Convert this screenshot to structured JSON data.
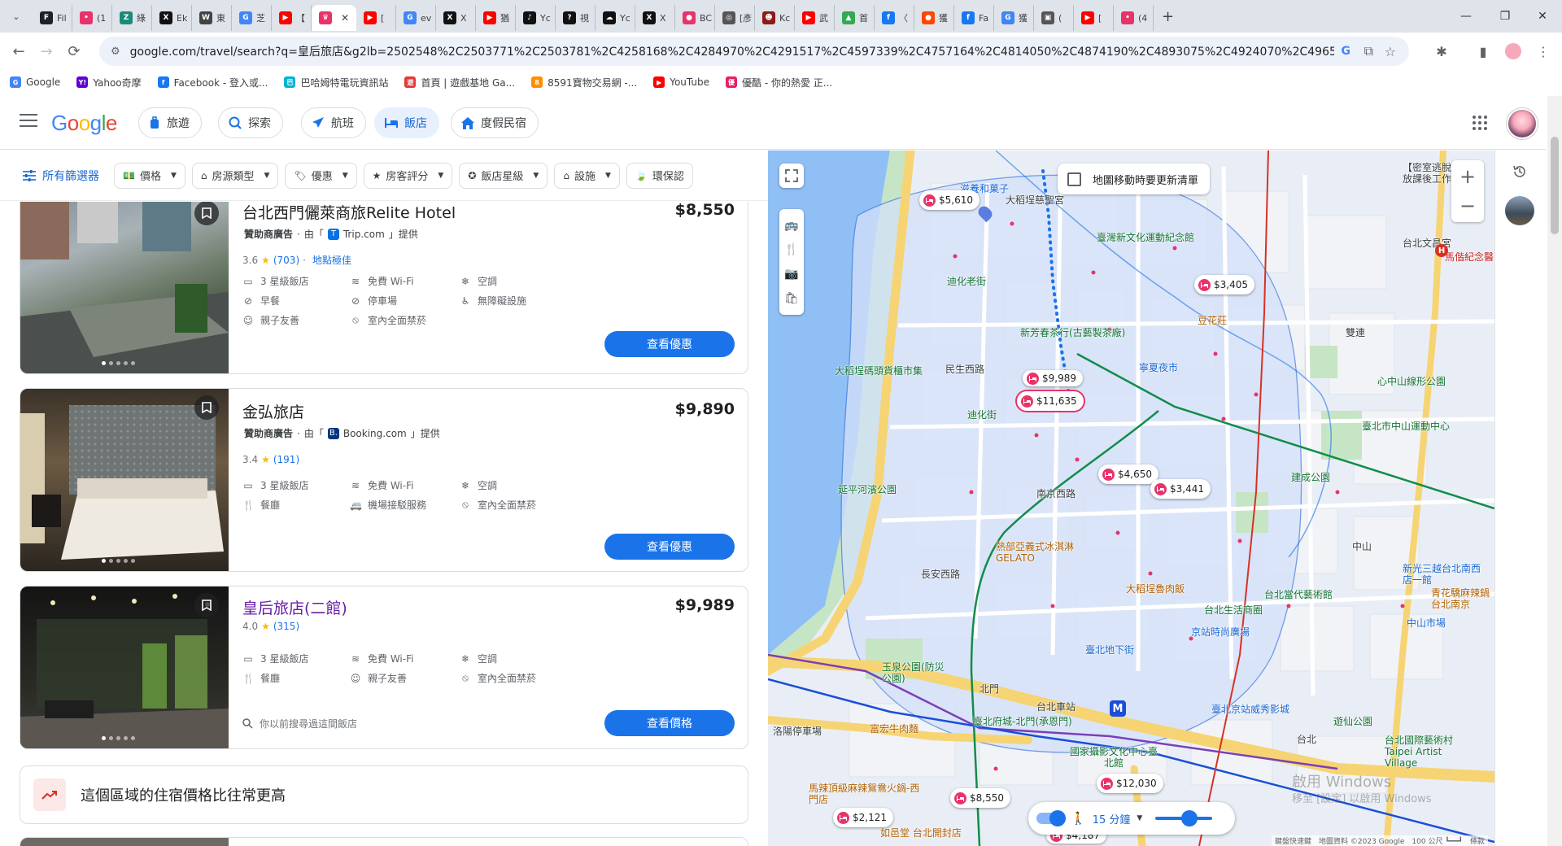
{
  "browser": {
    "tabs": [
      {
        "label": "Fil",
        "fav": "F",
        "color": "#202124"
      },
      {
        "label": "(1",
        "fav": "•",
        "color": "#e8336a"
      },
      {
        "label": "綠",
        "fav": "Z",
        "color": "#1a8b7a"
      },
      {
        "label": "Ek",
        "fav": "X",
        "color": "#111111"
      },
      {
        "label": "東",
        "fav": "W",
        "color": "#444444"
      },
      {
        "label": "芝",
        "fav": "G",
        "color": "#4285f4"
      },
      {
        "label": "【",
        "fav": "▶",
        "color": "#ff0000"
      },
      {
        "label": "",
        "fav": "♛",
        "color": "#e8336a",
        "active": true
      },
      {
        "label": "[",
        "fav": "▶",
        "color": "#ff0000"
      },
      {
        "label": "ev",
        "fav": "G",
        "color": "#4285f4"
      },
      {
        "label": "X",
        "fav": "X",
        "color": "#111111"
      },
      {
        "label": "猶",
        "fav": "▶",
        "color": "#ff0000"
      },
      {
        "label": "Yc",
        "fav": "♪",
        "color": "#111111"
      },
      {
        "label": "視",
        "fav": "?",
        "color": "#111111"
      },
      {
        "label": "Yc",
        "fav": "☁",
        "color": "#111111"
      },
      {
        "label": "X",
        "fav": "X",
        "color": "#111111"
      },
      {
        "label": "BC",
        "fav": "●",
        "color": "#e8336a"
      },
      {
        "label": "[彥",
        "fav": "◎",
        "color": "#555555"
      },
      {
        "label": "Kc",
        "fav": "☻",
        "color": "#8b1a1a"
      },
      {
        "label": "武",
        "fav": "▶",
        "color": "#ff0000"
      },
      {
        "label": "首",
        "fav": "▲",
        "color": "#34a853"
      },
      {
        "label": "〈",
        "fav": "f",
        "color": "#1877f2"
      },
      {
        "label": "獲",
        "fav": "●",
        "color": "#ff4500"
      },
      {
        "label": "Fa",
        "fav": "f",
        "color": "#1877f2"
      },
      {
        "label": "獲",
        "fav": "G",
        "color": "#4285f4"
      },
      {
        "label": "(",
        "fav": "▣",
        "color": "#555555"
      },
      {
        "label": "[",
        "fav": "▶",
        "color": "#ff0000"
      },
      {
        "label": "(4",
        "fav": "•",
        "color": "#e8336a"
      }
    ],
    "url": "google.com/travel/search?q=皇后旅店&g2lb=2502548%2C2503771%2C2503781%2C4258168%2C4284970%2C4291517%2C4597339%2C4757164%2C4814050%2C4874190%2C4893075%2C4924070%2C4965990%2C49904...",
    "bookmarks": [
      {
        "label": "Google",
        "fav": "G",
        "color": "#4285f4"
      },
      {
        "label": "Yahoo奇摩",
        "fav": "Y!",
        "color": "#6001d2"
      },
      {
        "label": "Facebook - 登入或...",
        "fav": "f",
        "color": "#1877f2"
      },
      {
        "label": "巴哈姆特電玩資訊站",
        "fav": "巴",
        "color": "#00b4d8"
      },
      {
        "label": "首頁 | 遊戲基地 Ga...",
        "fav": "遊",
        "color": "#e53935"
      },
      {
        "label": "8591寶物交易網 -...",
        "fav": "8",
        "color": "#ff8f00"
      },
      {
        "label": "YouTube",
        "fav": "▶",
        "color": "#ff0000"
      },
      {
        "label": "優酷 - 你的熱愛 正...",
        "fav": "優",
        "color": "#e91e63"
      }
    ]
  },
  "header": {
    "logo": "Google",
    "nav": [
      {
        "label": "旅遊",
        "icon": "luggage-icon",
        "active": false
      },
      {
        "label": "探索",
        "icon": "explore-icon",
        "active": false
      },
      {
        "label": "航班",
        "icon": "flight-icon",
        "active": false
      },
      {
        "label": "飯店",
        "icon": "hotel-icon",
        "active": true
      },
      {
        "label": "度假民宿",
        "icon": "home-icon",
        "active": false
      }
    ]
  },
  "filters": {
    "all_label": "所有篩選器",
    "chips": [
      {
        "label": "價格",
        "icon": "price-icon"
      },
      {
        "label": "房源類型",
        "icon": "property-icon"
      },
      {
        "label": "優惠",
        "icon": "tag-icon"
      },
      {
        "label": "房客評分",
        "icon": "star-icon"
      },
      {
        "label": "飯店星級",
        "icon": "hotel-class-icon"
      },
      {
        "label": "設施",
        "icon": "amenities-icon"
      },
      {
        "label": "環保認",
        "icon": "eco-icon"
      }
    ]
  },
  "results": [
    {
      "name": "台北西門儷萊商旅Relite Hotel",
      "price": "$8,550",
      "sponsored": "贊助商廣告",
      "provider_prefix": "由「",
      "provider": "Trip.com",
      "provider_suffix": "」提供",
      "rating": "3.6",
      "reviews": "(703)",
      "tag": "地點極佳",
      "amenities": [
        {
          "label": "3 星級飯店",
          "icon": "hotel-icon"
        },
        {
          "label": "免費 Wi-Fi",
          "icon": "wifi-icon"
        },
        {
          "label": "空調",
          "icon": "ac-icon"
        },
        {
          "label": "早餐",
          "icon": "no-breakfast-icon"
        },
        {
          "label": "停車場",
          "icon": "no-parking-icon"
        },
        {
          "label": "無障礙設施",
          "icon": "accessible-icon"
        },
        {
          "label": "親子友善",
          "icon": "family-icon"
        },
        {
          "label": "室內全面禁菸",
          "icon": "no-smoking-icon"
        }
      ],
      "cta": "查看優惠",
      "photo_colors": [
        "#6b7b8a",
        "#9aa5ac",
        "#3f5a3a"
      ]
    },
    {
      "name": "金弘旅店",
      "price": "$9,890",
      "sponsored": "贊助商廣告",
      "provider_prefix": "由「",
      "provider": "Booking.com",
      "provider_suffix": "」提供",
      "rating": "3.4",
      "reviews": "(191)",
      "tag": "",
      "amenities": [
        {
          "label": "3 星級飯店",
          "icon": "hotel-icon"
        },
        {
          "label": "免費 Wi-Fi",
          "icon": "wifi-icon"
        },
        {
          "label": "空調",
          "icon": "ac-icon"
        },
        {
          "label": "餐廳",
          "icon": "restaurant-icon"
        },
        {
          "label": "機場接駁服務",
          "icon": "shuttle-icon"
        },
        {
          "label": "室內全面禁菸",
          "icon": "no-smoking-icon"
        }
      ],
      "cta": "查看優惠",
      "photo_colors": [
        "#5a4a3a",
        "#d9d3c7",
        "#2b2b2b"
      ]
    },
    {
      "name": "皇后旅店(二館)",
      "price": "$9,989",
      "rating": "4.0",
      "reviews": "(315)",
      "amenities": [
        {
          "label": "3 星級飯店",
          "icon": "hotel-icon"
        },
        {
          "label": "免費 Wi-Fi",
          "icon": "wifi-icon"
        },
        {
          "label": "空調",
          "icon": "ac-icon"
        },
        {
          "label": "餐廳",
          "icon": "restaurant-icon"
        },
        {
          "label": "親子友善",
          "icon": "family-icon"
        },
        {
          "label": "室內全面禁菸",
          "icon": "no-smoking-icon"
        }
      ],
      "history": "你以前搜尋過這間飯店",
      "cta": "查看價格",
      "photo_colors": [
        "#1a1a1a",
        "#4a5a3a",
        "#6a5a4a"
      ]
    }
  ],
  "insight": "這個區域的住宿價格比往常更高",
  "map": {
    "checkbox_label": "地圖移動時要更新清單",
    "walk_label": "15 分鐘",
    "attribution": "鍵盤快速鍵　地圖資料 ©2023 Google　100 公尺 ┗━━┛　條款",
    "watermark_1": "啟用 Windows",
    "watermark_2": "移至 [設定] 以啟用 Windows",
    "pins": [
      {
        "price": "$5,610"
      },
      {
        "price": "$3,405"
      },
      {
        "price": "$9,989"
      },
      {
        "price": "$11,635"
      },
      {
        "price": "$4,650"
      },
      {
        "price": "$3,441"
      },
      {
        "price": "$8,550"
      },
      {
        "price": "$12,030"
      },
      {
        "price": "$2,121"
      },
      {
        "price": "$4,187"
      }
    ],
    "labels": [
      "滋養和菓子",
      "大稻埕慈聖宮",
      "大稻埕碼頭貨櫃市集",
      "迪化老街",
      "新芳春茶行(古藝製茶廠)",
      "臺灣新文化運動紀念館",
      "豆花莊",
      "寧夏夜市",
      "迪化街",
      "延平河濱公園",
      "建成公園",
      "熱部亞義式冰淇淋GELATO",
      "大稻埕魯肉飯",
      "台北當代藝術館",
      "台北生活商圈",
      "京站時尚廣場",
      "臺北地下街",
      "北門",
      "台北車站",
      "臺北府城-北門(承恩門)",
      "國家攝影文化中心臺北館",
      "富宏牛肉麵",
      "洛陽停車場",
      "馬辣頂級麻辣鴛鴦火鍋-西門店",
      "如邑堂 台北開封店",
      "臺北京站威秀影城",
      "遊仙公園",
      "台北國際藝術村 Taipei Artist Village",
      "民生西路",
      "南京西路",
      "長安西路",
      "中山",
      "雙連",
      "台北",
      "心中山線形公園",
      "臺北市中山運動中心",
      "馬偕紀念醫院",
      "台北文昌宮",
      "新光三越台北南西店一館",
      "青花驕麻辣鍋台北南京",
      "中山市場",
      "玉泉公園(防災公園)",
      "【密室逃脫】放課後工作"
    ]
  }
}
